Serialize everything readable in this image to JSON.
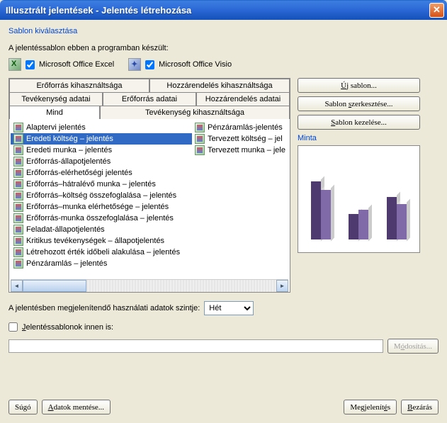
{
  "title": "Illusztrált jelentések - Jelentés létrehozása",
  "subtitle": "Sablon kiválasztása",
  "template_src_label": "A jelentéssablon ebben a programban készült:",
  "excel": {
    "label": "Microsoft Office Excel",
    "checked": true
  },
  "visio": {
    "label": "Microsoft Office Visio",
    "checked": true
  },
  "tabs_row1": [
    "Erőforrás kihasználtsága",
    "Hozzárendelés kihasználtsága"
  ],
  "tabs_row2": [
    "Tevékenység adatai",
    "Erőforrás adatai",
    "Hozzárendelés adatai"
  ],
  "tabs_row3": [
    "Mind",
    "Tevékenység kihasználtsága"
  ],
  "list_left": [
    "Alaptervi jelentés",
    "Eredeti költség – jelentés",
    "Eredeti munka – jelentés",
    "Erőforrás-állapotjelentés",
    "Erőforrás-elérhetőségi jelentés",
    "Erőforrás–hátralévő munka – jelentés",
    "Erőforrás–költség összefoglalása – jelentés",
    "Erőforrás–munka elérhetősége – jelentés",
    "Erőforrás-munka összefoglalása – jelentés",
    "Feladat-állapotjelentés",
    "Kritikus tevékenységek – állapotjelentés",
    "Létrehozott érték időbeli alakulása – jelentés",
    "Pénzáramlás – jelentés"
  ],
  "selected_index": 1,
  "list_right": [
    "Pénzáramlás-jelentés",
    "Tervezett költség – jel",
    "Tervezett munka – jele"
  ],
  "buttons_right": {
    "new": "Új sablon...",
    "edit": "Sablon szerkesztése...",
    "manage": "Sablon kezelése..."
  },
  "preview_label": "Minta",
  "level": {
    "label": "A jelentésben megjelenítendő használati adatok szintje:",
    "value": "Hét"
  },
  "from": {
    "label": "Jelentéssablonok innen is:",
    "checked": false,
    "value": ""
  },
  "modify_btn": "Módosítás...",
  "bottom": {
    "help": "Súgó",
    "save": "Adatok mentése...",
    "show": "Megjelenítés",
    "close": "Bezárás"
  },
  "chart_data": {
    "type": "bar",
    "series": [
      {
        "colors": [
          "#4e3a6e",
          "#816aa8"
        ],
        "groups": [
          [
            82,
            70
          ],
          [
            36,
            42
          ],
          [
            60,
            50
          ]
        ]
      }
    ]
  }
}
